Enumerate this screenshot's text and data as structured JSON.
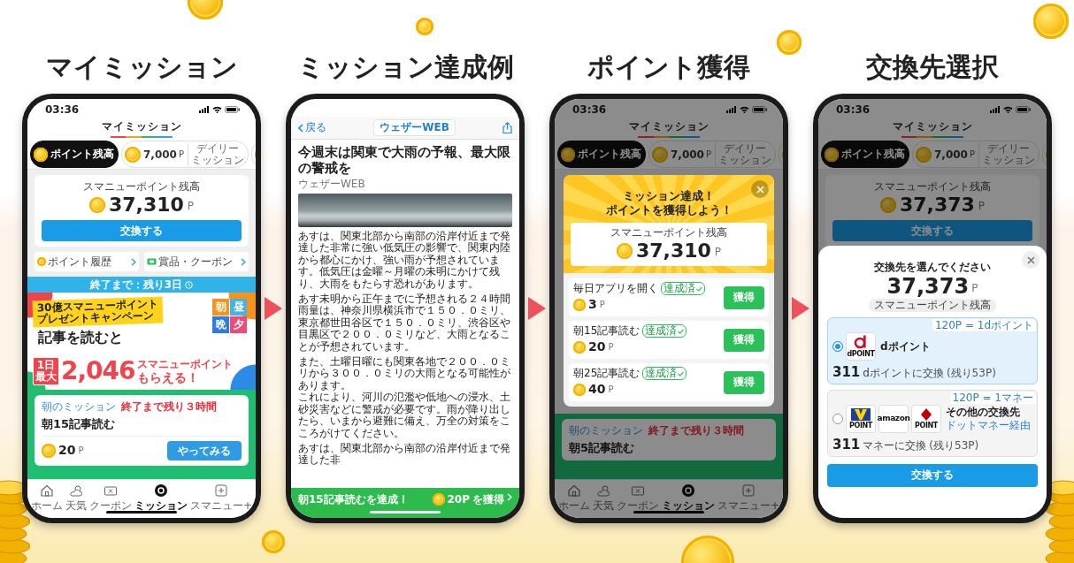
{
  "panels": [
    {
      "heading": "マイミッション",
      "screen": {
        "kind": "mission_home",
        "status_time": "03:36",
        "title": "マイミッション",
        "chips": [
          {
            "kind": "balance",
            "label": "ポイント残高",
            "selected": true
          },
          {
            "kind": "daily",
            "amount": "7,000",
            "unit": "P",
            "label_lines": [
              "デイリー",
              "ミッション"
            ],
            "selected": false
          },
          {
            "kind": "more",
            "selected": false
          }
        ],
        "balance": {
          "label": "スマニューポイント残高",
          "amount": "37,310",
          "unit": "P",
          "button": "交換する"
        },
        "links": [
          {
            "kind": "history",
            "label": "ポイント履歴"
          },
          {
            "kind": "coupon",
            "label": "賞品・クーポン"
          }
        ],
        "countdown": "終了まで：残り3日",
        "banner": {
          "ribbon_lines": [
            "30億スマニューポイント",
            "プレゼントキャンペーン"
          ],
          "headline": "記事を読むと",
          "tiles": [
            "朝",
            "昼",
            "晩",
            "夕"
          ],
          "badge_lines": [
            "1日",
            "最大"
          ],
          "figure": "2,046",
          "tail_top": "スマニューポイント",
          "tail_bottom": "もらえる！"
        },
        "mission": {
          "label": "朝のミッション",
          "deadline": "終了まで残り３時間",
          "title": "朝15記事読む",
          "reward": "20",
          "unit": "P",
          "button": "やってみる"
        },
        "tabbar": [
          {
            "kind": "home",
            "label": "ホーム",
            "selected": false
          },
          {
            "kind": "weather",
            "label": "天気",
            "selected": false
          },
          {
            "kind": "coupon",
            "label": "クーポン",
            "selected": false
          },
          {
            "kind": "mission",
            "label": "ミッション",
            "selected": true
          },
          {
            "kind": "plus",
            "label": "スマニュー+",
            "selected": false
          }
        ]
      }
    },
    {
      "heading": "ミッション達成例",
      "screen": {
        "kind": "article",
        "back": "戻る",
        "site": "ウェザーWEB",
        "headline": "今週末は関東で大雨の予報、最大限の警戒を",
        "source": "ウェザーWEB",
        "paragraphs": [
          {
            "lines": [
              "あすは、関東北部から南部の沿岸付近まで発達した非常に強い低気圧の影響で、関東内陸から都心にかけ、強い雨が予想されています。低気圧は金曜～月曜の未明にかけて残り、大雨をもたらす恐れがあります。"
            ]
          },
          {
            "lines": [
              "あす未明から正午までに予想される２４時間雨量は、神奈川県横浜市で１５０．０ミリ、東京都世田谷区で１５０．０ミリ、渋谷区や目黒区で２００．０ミリなど、大雨となることが予想されています。"
            ]
          },
          {
            "lines": [
              "また、土曜日曜にも関東各地で２００．０ミリから３００．０ミリの大雨となる可能性があります。",
              "これにより、河川の氾濫や低地への浸水、土砂災害などに警戒が必要です。雨が降り出したら、いまから避難に備え、万全の対策をこころがけてください。"
            ]
          },
          {
            "lines": [
              "あすは、関東北部から南部の沿岸付近まで発達した非"
            ]
          }
        ],
        "achievement": {
          "text": "朝15記事読むを達成！",
          "reward": "20P",
          "action": "を獲得"
        }
      }
    },
    {
      "heading": "ポイント獲得",
      "screen": {
        "kind": "mission_modal",
        "status_time": "03:36",
        "title": "マイミッション",
        "chips": [
          {
            "kind": "balance",
            "label": "ポイント残高",
            "selected": true
          },
          {
            "kind": "daily",
            "amount": "7,000",
            "unit": "P",
            "label_lines": [
              "デイリー",
              "ミッション"
            ],
            "selected": false
          },
          {
            "kind": "more",
            "selected": false
          }
        ],
        "modal": {
          "title_lines": [
            "ミッション達成！",
            "ポイントを獲得しよう！"
          ],
          "balance_label": "スマニューポイント残高",
          "amount": "37,310",
          "unit": "P",
          "rewards": [
            {
              "name": "毎日アプリを開く",
              "badge": "達成済",
              "points": "3",
              "unit": "P",
              "button": "獲得"
            },
            {
              "name": "朝15記事読む",
              "badge": "達成済",
              "points": "20",
              "unit": "P",
              "button": "獲得"
            },
            {
              "name": "朝25記事読む",
              "badge": "達成済",
              "points": "40",
              "unit": "P",
              "button": "獲得"
            }
          ]
        },
        "mission": {
          "label": "朝のミッション",
          "deadline": "終了まで残り３時間",
          "title": "朝5記事読む"
        },
        "tabbar": [
          {
            "kind": "home",
            "label": "ホーム",
            "selected": false
          },
          {
            "kind": "weather",
            "label": "天気",
            "selected": false
          },
          {
            "kind": "coupon",
            "label": "クーポン",
            "selected": false
          },
          {
            "kind": "mission",
            "label": "ミッション",
            "selected": true
          },
          {
            "kind": "plus",
            "label": "スマニュー+",
            "selected": false
          }
        ]
      }
    },
    {
      "heading": "交換先選択",
      "screen": {
        "kind": "exchange",
        "status_time": "03:36",
        "title": "マイミッション",
        "chips": [
          {
            "kind": "balance",
            "label": "ポイント残高",
            "selected": true
          },
          {
            "kind": "daily",
            "amount": "7,000",
            "unit": "P",
            "label_lines": [
              "デイリー",
              "ミッション"
            ],
            "selected": false
          },
          {
            "kind": "more",
            "selected": false
          }
        ],
        "balance": {
          "label": "スマニューポイント残高",
          "amount": "37,373",
          "unit": "P",
          "button": "交換する"
        },
        "sheet": {
          "title": "交換先を選んでください",
          "amount": "37,373",
          "unit": "P",
          "tag": "スマニューポイント残高",
          "options": [
            {
              "selected": true,
              "rate": "120P = 1dポイント",
              "name": "dポイント",
              "logos": [
                {
                  "kind": "ring",
                  "caption": "dPOINT"
                }
              ],
              "amount": "311",
              "desc": "dポイントに交換",
              "remain": "(残り53P)"
            },
            {
              "selected": false,
              "rate": "120P = 1マネー",
              "name": "その他の交換先",
              "via": "ドットマネー経由",
              "logos": [
                {
                  "kind": "vee",
                  "caption": "POINT"
                },
                {
                  "kind": "word",
                  "caption": "amazon"
                },
                {
                  "kind": "mark",
                  "caption": "POINT"
                }
              ],
              "amount": "311",
              "desc": "マネーに交換",
              "remain": "(残り53P)"
            }
          ],
          "button": "交換する"
        }
      }
    }
  ]
}
